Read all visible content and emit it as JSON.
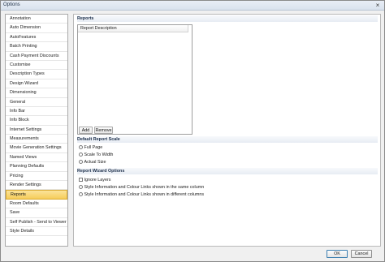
{
  "window": {
    "title": "Options"
  },
  "sidebar": {
    "items": [
      {
        "label": "Annotation"
      },
      {
        "label": "Auto Dimension"
      },
      {
        "label": "AutoFeatures"
      },
      {
        "label": "Batch Printing"
      },
      {
        "label": "Cash Payment Discounts"
      },
      {
        "label": "Customise"
      },
      {
        "label": "Description Types"
      },
      {
        "label": "Design Wizard"
      },
      {
        "label": "Dimensioning"
      },
      {
        "label": "General"
      },
      {
        "label": "Info Bar"
      },
      {
        "label": "Info Block"
      },
      {
        "label": "Internet Settings"
      },
      {
        "label": "Measurements"
      },
      {
        "label": "Movie Generation Settings"
      },
      {
        "label": "Named Views"
      },
      {
        "label": "Planning Defaults"
      },
      {
        "label": "Pricing"
      },
      {
        "label": "Render Settings"
      },
      {
        "label": "Reports"
      },
      {
        "label": "Room Defaults"
      },
      {
        "label": "Save"
      },
      {
        "label": "Self Publish - Send to Viewer"
      },
      {
        "label": "Style Details"
      }
    ],
    "selected": "Reports"
  },
  "main": {
    "reports_header": "Reports",
    "list_column": "Report Description",
    "add_label": "Add",
    "remove_label": "Remove",
    "scale_header": "Default Report Scale",
    "scale_options": [
      "Full Page",
      "Scale To Width",
      "Actual Size"
    ],
    "wizard_header": "Report Wizard Options",
    "ignore_layers_label": "Ignore Layers",
    "wizard_options": [
      "Style Information and Colour Links shown in the same column",
      "Style Information and Colour Links shown in different columns"
    ]
  },
  "footer": {
    "ok_label": "OK",
    "cancel_label": "Cancel"
  }
}
